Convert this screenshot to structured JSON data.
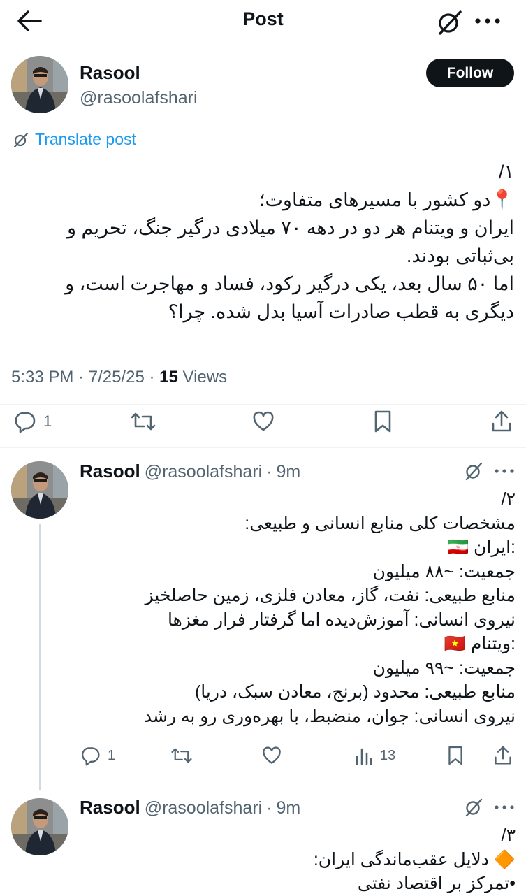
{
  "header": {
    "title": "Post"
  },
  "main_post": {
    "author": {
      "name": "Rasool",
      "handle": "@rasoolafshari"
    },
    "follow_label": "Follow",
    "translate_label": "Translate post",
    "text_lines": [
      "/۱",
      "📍دو کشور با مسیرهای متفاوت؛",
      "ایران و ویتنام هر دو در دهه ۷۰ میلادی درگیر جنگ، تحریم و",
      "بی‌ثباتی بودند.",
      "اما ۵۰ سال بعد، یکی درگیر رکود، فساد و مهاجرت است، و",
      "دیگری به قطب صادرات آسیا بدل شده. چرا؟"
    ],
    "time": "5:33 PM",
    "date": "7/25/25",
    "views_count": "15",
    "views_label": "Views",
    "reply_count": "1"
  },
  "replies": [
    {
      "name": "Rasool",
      "handle": "@rasoolafshari",
      "time": "9m",
      "text_lines": [
        "/۲",
        "مشخصات کلی منابع انسانی و طبیعی:",
        "🇮🇷 ایران:",
        "جمعیت: ~۸۸ میلیون",
        "منابع طبیعی: نفت، گاز، معادن فلزی، زمین حاصلخیز",
        "نیروی انسانی: آموزش‌دیده اما گرفتار فرار مغزها",
        "🇻🇳 ویتنام:",
        "جمعیت: ~۹۹ میلیون",
        "منابع طبیعی: محدود (برنج، معادن سبک، دریا)",
        "نیروی انسانی: جوان، منضبط، با بهره‌وری رو به رشد"
      ],
      "reply_count": "1",
      "views_count": "13"
    },
    {
      "name": "Rasool",
      "handle": "@rasoolafshari",
      "time": "9m",
      "text_lines": [
        "/۳",
        "🔶 دلایل عقب‌ماندگی ایران:",
        "•تمرکز بر اقتصاد نفتی"
      ]
    }
  ],
  "colors": {
    "accent": "#1d9bf0",
    "text": "#0f1419",
    "muted": "#536471",
    "line": "#cfd9de"
  },
  "icons": [
    "back-arrow-icon",
    "grok-icon",
    "more-icon",
    "translate-icon",
    "reply-icon",
    "repost-icon",
    "like-icon",
    "bookmark-icon",
    "share-icon",
    "views-icon"
  ]
}
